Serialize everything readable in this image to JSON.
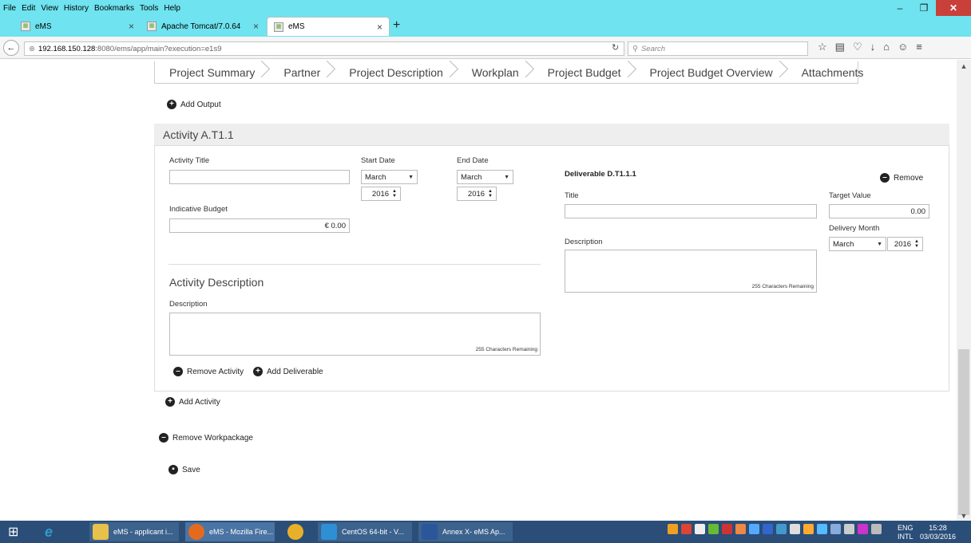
{
  "browser": {
    "menu": [
      "File",
      "Edit",
      "View",
      "History",
      "Bookmarks",
      "Tools",
      "Help"
    ],
    "tabs": [
      {
        "label": "eMS"
      },
      {
        "label": "Apache Tomcat/7.0.64"
      },
      {
        "label": "eMS"
      }
    ],
    "url_host": "192.168.150.128",
    "url_rest": ":8080/ems/app/main?execution=e1s9",
    "search_placeholder": "Search"
  },
  "wizard": {
    "steps": [
      "Project Summary",
      "Partner",
      "Project Description",
      "Workplan",
      "Project Budget",
      "Project Budget Overview",
      "Attachments"
    ]
  },
  "actions": {
    "add_output": "Add Output",
    "add_activity": "Add Activity",
    "remove_workpackage": "Remove Workpackage",
    "save": "Save"
  },
  "activity": {
    "heading": "Activity A.T1.1",
    "title_label": "Activity Title",
    "title_value": "",
    "start_date_label": "Start Date",
    "start_month": "March",
    "start_year": "2016",
    "end_date_label": "End Date",
    "end_month": "March",
    "end_year": "2016",
    "budget_label": "Indicative Budget",
    "budget_value": "€ 0.00",
    "description_heading": "Activity Description",
    "description_label": "Description",
    "description_remaining": "255 Characters Remaining",
    "remove_activity": "Remove Activity",
    "add_deliverable": "Add Deliverable"
  },
  "deliverable": {
    "heading": "Deliverable D.T1.1.1",
    "remove": "Remove",
    "title_label": "Title",
    "target_label": "Target Value",
    "target_value": "0.00",
    "delivery_month_label": "Delivery Month",
    "delivery_month": "March",
    "delivery_year": "2016",
    "description_label": "Description",
    "description_remaining": "255 Characters Remaining"
  },
  "taskbar": {
    "items": [
      "eMS - applicant i...",
      "eMS - Mozilla Fire...",
      "CentOS 64-bit - V...",
      "Annex X- eMS Ap..."
    ],
    "lang_top": "ENG",
    "lang_bottom": "INTL",
    "time": "15:28",
    "date": "03/03/2016"
  },
  "colors": {
    "titlebar": "#6fe3ef",
    "close": "#c9403a",
    "taskbar": "#2a4e78"
  }
}
